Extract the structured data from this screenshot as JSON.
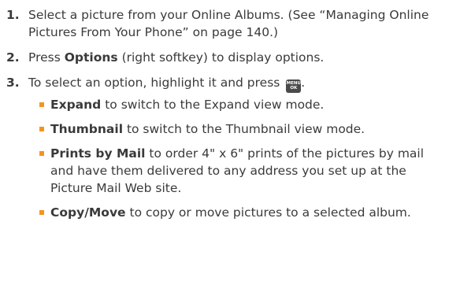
{
  "steps": [
    {
      "number": "1.",
      "text": "Select a picture from your Online Albums. (See “Managing Online Pictures From Your Phone” on page 140.)"
    },
    {
      "number": "2.",
      "pre": "Press ",
      "bold": "Options",
      "post": " (right softkey) to display options."
    },
    {
      "number": "3.",
      "text": "To select an option, highlight it and press ",
      "key_line1": "MENU",
      "key_line2": "OK",
      "suffix": "."
    }
  ],
  "options": [
    {
      "term": "Expand",
      "desc": " to switch to the Expand view mode."
    },
    {
      "term": "Thumbnail",
      "desc": " to switch to the Thumbnail view mode."
    },
    {
      "term": "Prints by Mail",
      "desc": " to order 4\" x 6\" prints of the pictures by mail and have them delivered to any address you set up at the Picture Mail Web site."
    },
    {
      "term": "Copy/Move",
      "desc": " to copy or move pictures to a selected album."
    }
  ],
  "colors": {
    "text": "#3a3a3a",
    "bullet": "#f4941e",
    "key_bg": "#4a4a4a"
  },
  "icons": {
    "menu_key": "menu-ok-key-icon",
    "bullet": "square-bullet-icon"
  }
}
